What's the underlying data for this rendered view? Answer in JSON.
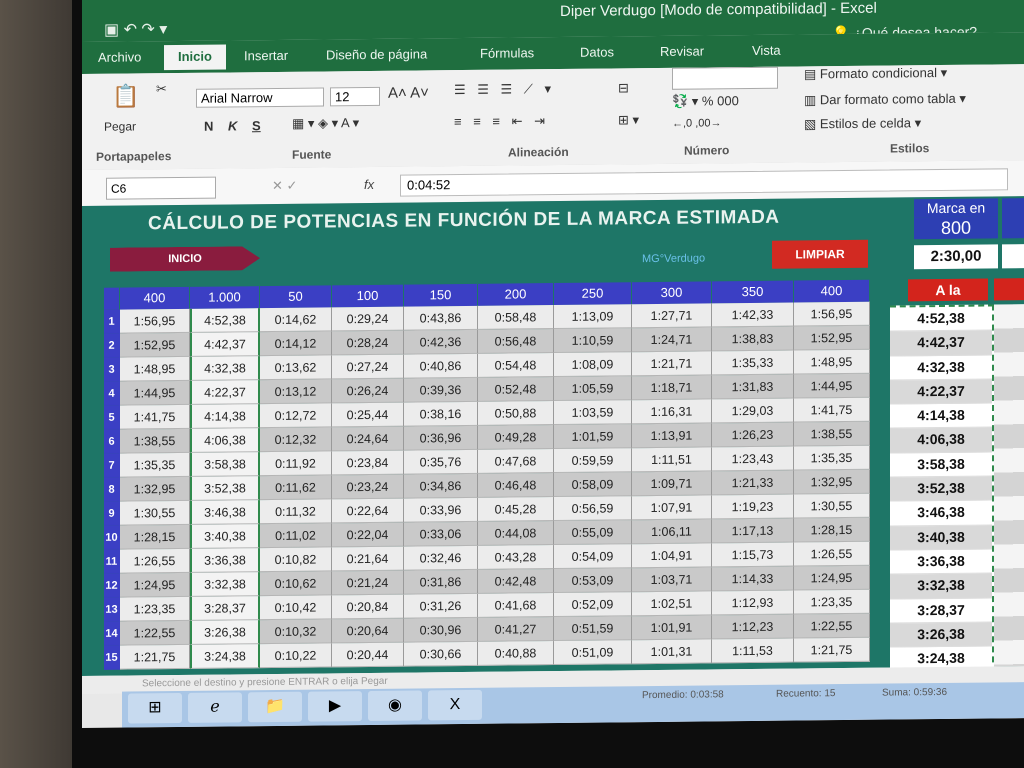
{
  "window": {
    "title": "Diper Verdugo  [Modo de compatibilidad] - Excel",
    "tell_me": "¿Qué desea hacer?"
  },
  "tabs": [
    "Archivo",
    "Inicio",
    "Insertar",
    "Diseño de página",
    "Fórmulas",
    "Datos",
    "Revisar",
    "Vista"
  ],
  "ribbon": {
    "paste_label": "Pegar",
    "font_name": "Arial Narrow",
    "font_size": "12",
    "conditional_format": "Formato condicional",
    "format_as_table": "Dar formato como tabla",
    "cell_styles": "Estilos de celda",
    "group_portapapeles": "Portapapeles",
    "group_fuente": "Fuente",
    "group_alineacion": "Alineación",
    "group_numero": "Número",
    "group_estilos": "Estilos",
    "bold": "N",
    "italic": "K",
    "underline": "S"
  },
  "formula_bar": {
    "cell_ref": "C6",
    "fx": "fx",
    "value": "0:04:52"
  },
  "sheet": {
    "title": "CÁLCULO DE POTENCIAS EN FUNCIÓN DE LA MARCA ESTIMADA",
    "inicio_button": "INICIO",
    "limpiar_button": "LIMPIAR",
    "author": "MG°Verdugo",
    "marca_label": "Marca en",
    "marca_value": "800",
    "marca_time": "2:30,00",
    "ala_header": "A la",
    "headers": [
      "400",
      "1.000",
      "50",
      "100",
      "150",
      "200",
      "250",
      "300",
      "350",
      "400"
    ],
    "rows": [
      [
        "1",
        "1:56,95",
        "4:52,38",
        "0:14,62",
        "0:29,24",
        "0:43,86",
        "0:58,48",
        "1:13,09",
        "1:27,71",
        "1:42,33",
        "1:56,95"
      ],
      [
        "2",
        "1:52,95",
        "4:42,37",
        "0:14,12",
        "0:28,24",
        "0:42,36",
        "0:56,48",
        "1:10,59",
        "1:24,71",
        "1:38,83",
        "1:52,95"
      ],
      [
        "3",
        "1:48,95",
        "4:32,38",
        "0:13,62",
        "0:27,24",
        "0:40,86",
        "0:54,48",
        "1:08,09",
        "1:21,71",
        "1:35,33",
        "1:48,95"
      ],
      [
        "4",
        "1:44,95",
        "4:22,37",
        "0:13,12",
        "0:26,24",
        "0:39,36",
        "0:52,48",
        "1:05,59",
        "1:18,71",
        "1:31,83",
        "1:44,95"
      ],
      [
        "5",
        "1:41,75",
        "4:14,38",
        "0:12,72",
        "0:25,44",
        "0:38,16",
        "0:50,88",
        "1:03,59",
        "1:16,31",
        "1:29,03",
        "1:41,75"
      ],
      [
        "6",
        "1:38,55",
        "4:06,38",
        "0:12,32",
        "0:24,64",
        "0:36,96",
        "0:49,28",
        "1:01,59",
        "1:13,91",
        "1:26,23",
        "1:38,55"
      ],
      [
        "7",
        "1:35,35",
        "3:58,38",
        "0:11,92",
        "0:23,84",
        "0:35,76",
        "0:47,68",
        "0:59,59",
        "1:11,51",
        "1:23,43",
        "1:35,35"
      ],
      [
        "8",
        "1:32,95",
        "3:52,38",
        "0:11,62",
        "0:23,24",
        "0:34,86",
        "0:46,48",
        "0:58,09",
        "1:09,71",
        "1:21,33",
        "1:32,95"
      ],
      [
        "9",
        "1:30,55",
        "3:46,38",
        "0:11,32",
        "0:22,64",
        "0:33,96",
        "0:45,28",
        "0:56,59",
        "1:07,91",
        "1:19,23",
        "1:30,55"
      ],
      [
        "10",
        "1:28,15",
        "3:40,38",
        "0:11,02",
        "0:22,04",
        "0:33,06",
        "0:44,08",
        "0:55,09",
        "1:06,11",
        "1:17,13",
        "1:28,15"
      ],
      [
        "11",
        "1:26,55",
        "3:36,38",
        "0:10,82",
        "0:21,64",
        "0:32,46",
        "0:43,28",
        "0:54,09",
        "1:04,91",
        "1:15,73",
        "1:26,55"
      ],
      [
        "12",
        "1:24,95",
        "3:32,38",
        "0:10,62",
        "0:21,24",
        "0:31,86",
        "0:42,48",
        "0:53,09",
        "1:03,71",
        "1:14,33",
        "1:24,95"
      ],
      [
        "13",
        "1:23,35",
        "3:28,37",
        "0:10,42",
        "0:20,84",
        "0:31,26",
        "0:41,68",
        "0:52,09",
        "1:02,51",
        "1:12,93",
        "1:23,35"
      ],
      [
        "14",
        "1:22,55",
        "3:26,38",
        "0:10,32",
        "0:20,64",
        "0:30,96",
        "0:41,27",
        "0:51,59",
        "1:01,91",
        "1:12,23",
        "1:22,55"
      ],
      [
        "15",
        "1:21,75",
        "3:24,38",
        "0:10,22",
        "0:20,44",
        "0:30,66",
        "0:40,88",
        "0:51,09",
        "1:01,31",
        "1:11,53",
        "1:21,75"
      ]
    ],
    "ala_values": [
      "4:52,38",
      "4:42,37",
      "4:32,38",
      "4:22,37",
      "4:14,38",
      "4:06,38",
      "3:58,38",
      "3:52,38",
      "3:46,38",
      "3:40,38",
      "3:36,38",
      "3:32,38",
      "3:28,37",
      "3:26,38",
      "3:24,38"
    ]
  },
  "status": {
    "message": "Seleccione el destino y presione ENTRAR o elija Pegar",
    "promedio": "Promedio: 0:03:58",
    "recuento": "Recuento: 15",
    "suma": "Suma: 0:59:36"
  }
}
